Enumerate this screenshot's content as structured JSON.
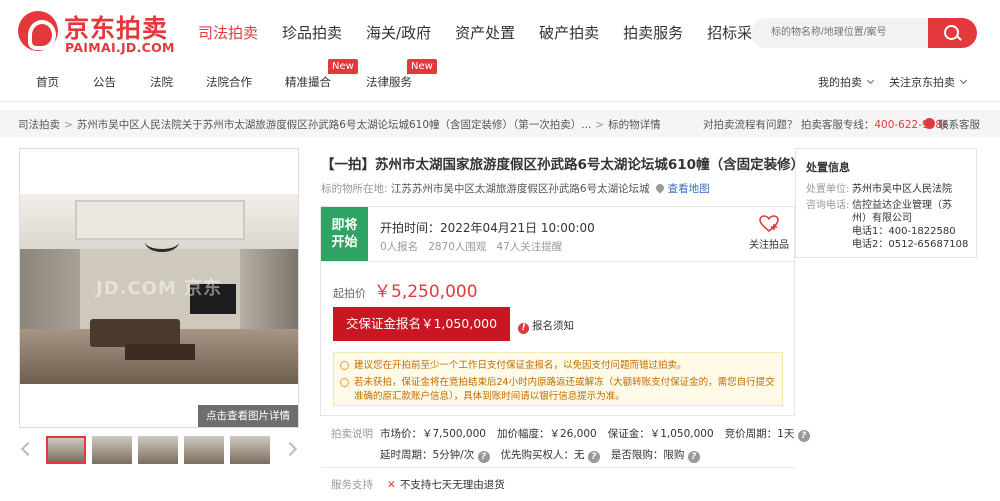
{
  "header": {
    "logo_cn": "京东拍卖",
    "logo_en": "PAIMAI.JD.COM",
    "nav": [
      "司法拍卖",
      "珍品拍卖",
      "海关/政府",
      "资产处置",
      "破产拍卖",
      "拍卖服务",
      "招标采购"
    ],
    "search_placeholder": "标的物名称/地理位置/案号"
  },
  "subnav": {
    "items": [
      "首页",
      "公告",
      "法院",
      "法院合作",
      "精准撮合",
      "法律服务"
    ],
    "badge": "New",
    "my_auction": "我的拍卖",
    "follow_jd": "关注京东拍卖"
  },
  "breadcrumb": {
    "items": [
      "司法拍卖",
      "苏州市吴中区人民法院关于苏州市太湖旅游度假区孙武路6号太湖论坛城610幢（含固定装修）（第一次拍卖）...",
      "标的物详情"
    ],
    "sep": ">",
    "help": "对拍卖流程有问题？ 拍卖客服专线：",
    "phone": "400-622-9586",
    "contact": "联系客服"
  },
  "gallery": {
    "watermark": "JD.COM 京东",
    "detail_btn": "点击查看图片详情"
  },
  "item": {
    "title": "【一拍】苏州市太湖国家旅游度假区孙武路6号太湖论坛城610幢（含固定装修）",
    "location_label": "标的物所在地:",
    "location": "江苏苏州市吴中区太湖旅游度假区孙武路6号太湖论坛城",
    "map_link": "查看地图",
    "status_line1": "即将",
    "status_line2": "开始",
    "start_time": "开拍时间：2022年04月21日 10:00:00",
    "signups": "0人报名",
    "views": "2870人围观",
    "reminders": "47人关注提醒",
    "follow": "关注拍品",
    "start_price_label": "起拍价",
    "start_price": "￥5,250,000",
    "deposit_btn": "交保证金报名￥1,050,000",
    "notice": "报名须知",
    "tips": [
      "建议您在开拍前至少一个工作日支付保证金报名，以免因支付问题而错过拍卖。",
      "若未获拍，保证金将在竞拍结束后24小时内原路返还或解冻（大额转账支付保证金的，需您自行提交准确的原汇款账户信息），具体到账时间请以银行信息提示为准。"
    ]
  },
  "auction_info": {
    "label": "拍卖说明",
    "row1": [
      "市场价：￥7,500,000",
      "加价幅度：￥26,000",
      "保证金：￥1,050,000",
      "竞价周期：1天"
    ],
    "row2": [
      "延时周期：5分钟/次",
      "优先购买权人：无",
      "是否限购：限购"
    ]
  },
  "service": {
    "label": "服务支持",
    "value": "不支持七天无理由退货"
  },
  "sidebar": {
    "title": "处置信息",
    "unit_label": "处置单位:",
    "unit": "苏州市吴中区人民法院",
    "contact_label": "咨询电话:",
    "contact_org_line1": "信控益达企业管理（苏",
    "contact_org_line2": "州）有限公司",
    "phone1": "电话1：400-1822580",
    "phone2": "电话2：0512-65687108"
  },
  "colors": {
    "brand_red": "#e4393c",
    "button_red": "#c81623",
    "status_green": "#2fa363",
    "link_blue": "#3a6fc5"
  }
}
